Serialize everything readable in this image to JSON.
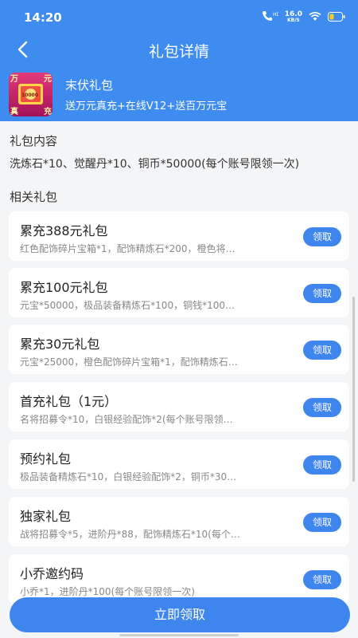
{
  "status": {
    "time": "14:20",
    "speed_value": "16.0",
    "speed_unit": "KB/S",
    "icons": [
      "hd-call-icon",
      "wifi-icon",
      "battery-icon"
    ]
  },
  "nav": {
    "title": "礼包详情",
    "back_icon": "chevron-left-icon"
  },
  "pack": {
    "name": "末伏礼包",
    "desc": "送万元真充+在线V12+送百万元宝",
    "icon_texts": [
      "万",
      "元",
      "真",
      "充"
    ],
    "icon_center": "10000"
  },
  "contents": {
    "title": "礼包内容",
    "text": "洗炼石*10、觉醒丹*10、铜币*50000(每个账号限领一次)"
  },
  "related": {
    "title": "相关礼包",
    "items": [
      {
        "title": "累充388元礼包",
        "desc": "红色配饰碎片宝箱*1，配饰精炼石*200，橙色将…",
        "button": "领取"
      },
      {
        "title": "累充100元礼包",
        "desc": "元宝*50000，极品装备精炼石*100，铜钱*100…",
        "button": "领取"
      },
      {
        "title": "累充30元礼包",
        "desc": "元宝*25000，橙色配饰碎片宝箱*1，配饰精炼石…",
        "button": "领取"
      },
      {
        "title": "首充礼包（1元）",
        "desc": "名将招募令*10，白银经验配饰*2(每个账号限领…",
        "button": "领取"
      },
      {
        "title": "预约礼包",
        "desc": "极品装备精炼石*10，白银经验配饰*2，铜币*30…",
        "button": "领取"
      },
      {
        "title": "独家礼包",
        "desc": "战将招募令*5，进阶丹*88，配饰精炼石*10(每个…",
        "button": "领取"
      },
      {
        "title": "小乔邀约码",
        "desc": "小乔*1，进阶丹*100(每个账号限领一次)",
        "button": "领取"
      }
    ]
  },
  "bottom": {
    "claim_label": "立即领取"
  },
  "colors": {
    "primary": "#3f8cf0",
    "button": "#3f85ee",
    "background": "#f4f5f7"
  }
}
